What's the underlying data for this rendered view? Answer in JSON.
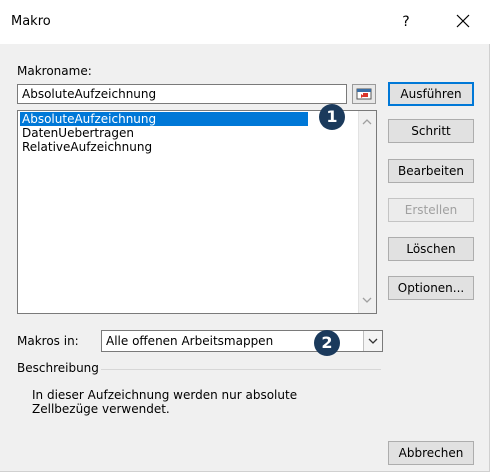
{
  "window": {
    "title": "Makro",
    "help_label": "?"
  },
  "macro_name_label": "Makroname:",
  "macro_name_value": "AbsoluteAufzeichnung",
  "macros": [
    "AbsoluteAufzeichnung",
    "DatenUebertragen",
    "RelativeAufzeichnung"
  ],
  "selected_index": 0,
  "buttons": {
    "run": "Ausführen",
    "step": "Schritt",
    "edit": "Bearbeiten",
    "create": "Erstellen",
    "delete": "Löschen",
    "options": "Optionen...",
    "cancel": "Abbrechen"
  },
  "macros_in": {
    "label": "Makros in:",
    "value": "Alle offenen Arbeitsmappen"
  },
  "description": {
    "label": "Beschreibung",
    "line1": "In dieser Aufzeichnung werden nur absolute",
    "line2": "Zellbezüge verwendet."
  },
  "badges": [
    "1",
    "2"
  ],
  "colors": {
    "selection": "#0078d7",
    "badge": "#1b3a5c",
    "default_button_border": "#0078d7"
  }
}
